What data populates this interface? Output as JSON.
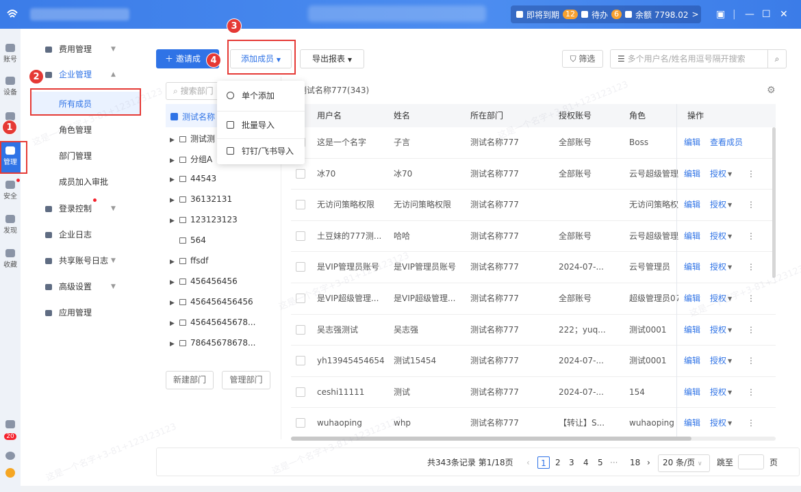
{
  "topbar": {
    "expiring_label": "即将到期",
    "expiring_count": "12",
    "todo_label": "待办",
    "todo_count": "6",
    "balance_label": "余额 7798.02",
    "more": ">"
  },
  "leftnav": {
    "items": [
      "账号",
      "设备",
      "",
      "管理",
      "安全",
      "发现",
      "收藏"
    ],
    "badge": "20"
  },
  "sidebar": {
    "fee": "费用管理",
    "enterprise": "企业管理",
    "all_members": "所有成员",
    "roles": "角色管理",
    "departments": "部门管理",
    "join_review": "成员加入审批",
    "login_control": "登录控制",
    "enterprise_log": "企业日志",
    "shared_log": "共享账号日志",
    "advanced": "高级设置",
    "apps": "应用管理"
  },
  "toolbar": {
    "invite": "邀请成",
    "add_member": "添加成员",
    "export": "导出报表",
    "filter": "筛选",
    "search_placeholder": "多个用户名/姓名用逗号隔开搜索"
  },
  "markers": [
    "1",
    "2",
    "3",
    "4"
  ],
  "dropdown": {
    "items": [
      "单个添加",
      "批量导入",
      "钉钉/飞书导入"
    ]
  },
  "dept": {
    "search_placeholder": "搜索部门",
    "root": "测试名称",
    "nodes": [
      "测试测",
      "分组A",
      "44543",
      "36132131",
      "123123123",
      "564",
      "ffsdf",
      "456456456",
      "456456456456",
      "45645645678...",
      "78645678678..."
    ],
    "new_dept": "新建部门",
    "manage_dept": "管理部门"
  },
  "table": {
    "title": "测试名称777(343)",
    "headers": [
      "用户名",
      "姓名",
      "所在部门",
      "授权账号",
      "角色",
      "操作"
    ],
    "rows": [
      {
        "user": "这是一个名字",
        "name": "子言",
        "dept": "测试名称777",
        "auth": "全部账号",
        "role": "Boss",
        "op1": "编辑",
        "op2": "查看成员"
      },
      {
        "user": "冰70",
        "name": "冰70",
        "dept": "测试名称777",
        "auth": "全部账号",
        "role": "云号超级管理",
        "op1": "编辑",
        "op2": "授权"
      },
      {
        "user": "无访问策略权限",
        "name": "无访问策略权限",
        "dept": "测试名称777",
        "auth": "",
        "role": "无访问策略权",
        "op1": "编辑",
        "op2": "授权"
      },
      {
        "user": "土豆妹的777测...",
        "name": "哈哈",
        "dept": "测试名称777",
        "auth": "全部账号",
        "role": "云号超级管理",
        "op1": "编辑",
        "op2": "授权"
      },
      {
        "user": "是VIP管理员账号",
        "name": "是VIP管理员账号",
        "dept": "测试名称777",
        "auth": "2024-07-...",
        "role": "云号管理员",
        "op1": "编辑",
        "op2": "授权"
      },
      {
        "user": "是VIP超级管理...",
        "name": "是VIP超级管理...",
        "dept": "测试名称777",
        "auth": "全部账号",
        "role": "超级管理员07",
        "op1": "编辑",
        "op2": "授权"
      },
      {
        "user": "吴志强测试",
        "name": "吴志强",
        "dept": "测试名称777",
        "auth": "222；yuq...",
        "role": "测试0001",
        "op1": "编辑",
        "op2": "授权"
      },
      {
        "user": "yh13945454654",
        "name": "测试15454",
        "dept": "测试名称777",
        "auth": "2024-07-...",
        "role": "测试0001",
        "op1": "编辑",
        "op2": "授权"
      },
      {
        "user": "ceshi11111",
        "name": "测试",
        "dept": "测试名称777",
        "auth": "2024-07-...",
        "role": "154",
        "op1": "编辑",
        "op2": "授权"
      },
      {
        "user": "wuhaoping",
        "name": "whp",
        "dept": "测试名称777",
        "auth": "【转让】S...",
        "role": "wuhaoping",
        "op1": "编辑",
        "op2": "授权"
      }
    ]
  },
  "pager": {
    "summary": "共343条记录 第1/18页",
    "pages": [
      "1",
      "2",
      "3",
      "4",
      "5",
      "···",
      "18"
    ],
    "page_size": "20 条/页",
    "jump": "跳至",
    "page_unit": "页"
  },
  "watermark": "这是一个名字+3-81+123123123"
}
